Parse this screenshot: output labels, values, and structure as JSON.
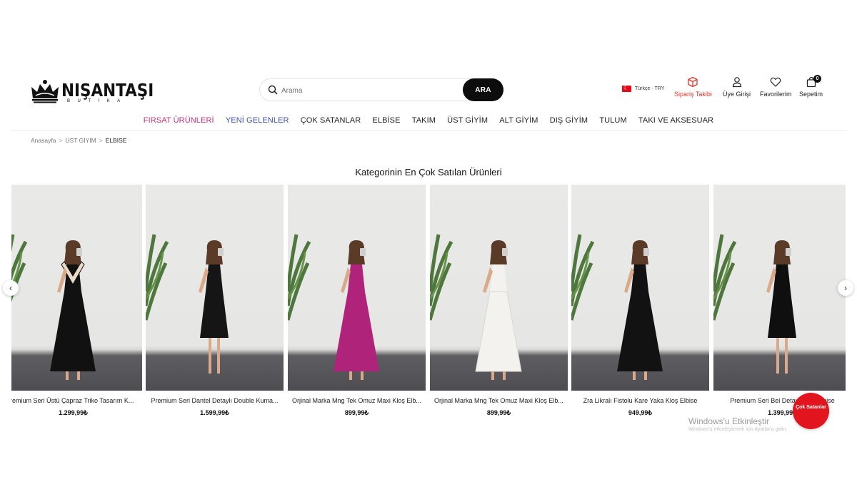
{
  "brand": {
    "name": "NIŞANTAŞI",
    "tagline": "BUTIKA"
  },
  "search": {
    "placeholder": "Arama",
    "button": "ARA"
  },
  "header": {
    "lang": "Türkçe - TRY",
    "order_tracking": "Sipariş Takibi",
    "login": "Üye Girişi",
    "favorites": "Favorilerim",
    "cart": "Sepetim",
    "cart_count": "0"
  },
  "nav": [
    "FIRSAT ÜRÜNLERİ",
    "YENİ GELENLER",
    "ÇOK SATANLAR",
    "ELBİSE",
    "TAKIM",
    "ÜST GİYİM",
    "ALT GİYİM",
    "DIŞ GİYİM",
    "TULUM",
    "TAKI VE AKSESUAR"
  ],
  "colors": {
    "nav_sale": "#c43172",
    "nav_new": "#3a53a8",
    "order_tracking": "#e0342a",
    "badge": "#e2141d"
  },
  "breadcrumb": [
    "Anasayfa",
    "ÜST GİYİM",
    "ELBİSE"
  ],
  "section_title": "Kategorinin En Çok Satılan Ürünleri",
  "products": [
    {
      "name": "Premium Seri Üstü Çapraz Triko Tasarım K...",
      "price": "1.299,99₺",
      "dress": "#111111",
      "top": "stripe"
    },
    {
      "name": "Premium Seri Dantel Detaylı Double Kuma...",
      "price": "1.599,99₺",
      "dress": "#151515",
      "top": "plain"
    },
    {
      "name": "Orjinal Marka Mng Tek Omuz Maxi Kloş Elb...",
      "price": "899,99₺",
      "dress": "#b0237a",
      "top": "plain"
    },
    {
      "name": "Orjinal Marka Mng Tek Omuz Maxi Kloş Elb...",
      "price": "899,99₺",
      "dress": "#f4f2ee",
      "top": "plain"
    },
    {
      "name": "Zra Likralı Fistolu Kare Yaka Kloş Elbise",
      "price": "949,99₺",
      "dress": "#121212",
      "top": "plain"
    },
    {
      "name": "Premium Seri Bel Detaylı Mini Elbise",
      "price": "1.399,99₺",
      "dress": "#0f0f0f",
      "top": "plain"
    }
  ],
  "floating_badge": "Çok Satanlar",
  "watermark": {
    "title": "Windows'u Etkinleştir",
    "sub": "Windows'u etkinleştirmek için Ayarlar'a gidin."
  }
}
